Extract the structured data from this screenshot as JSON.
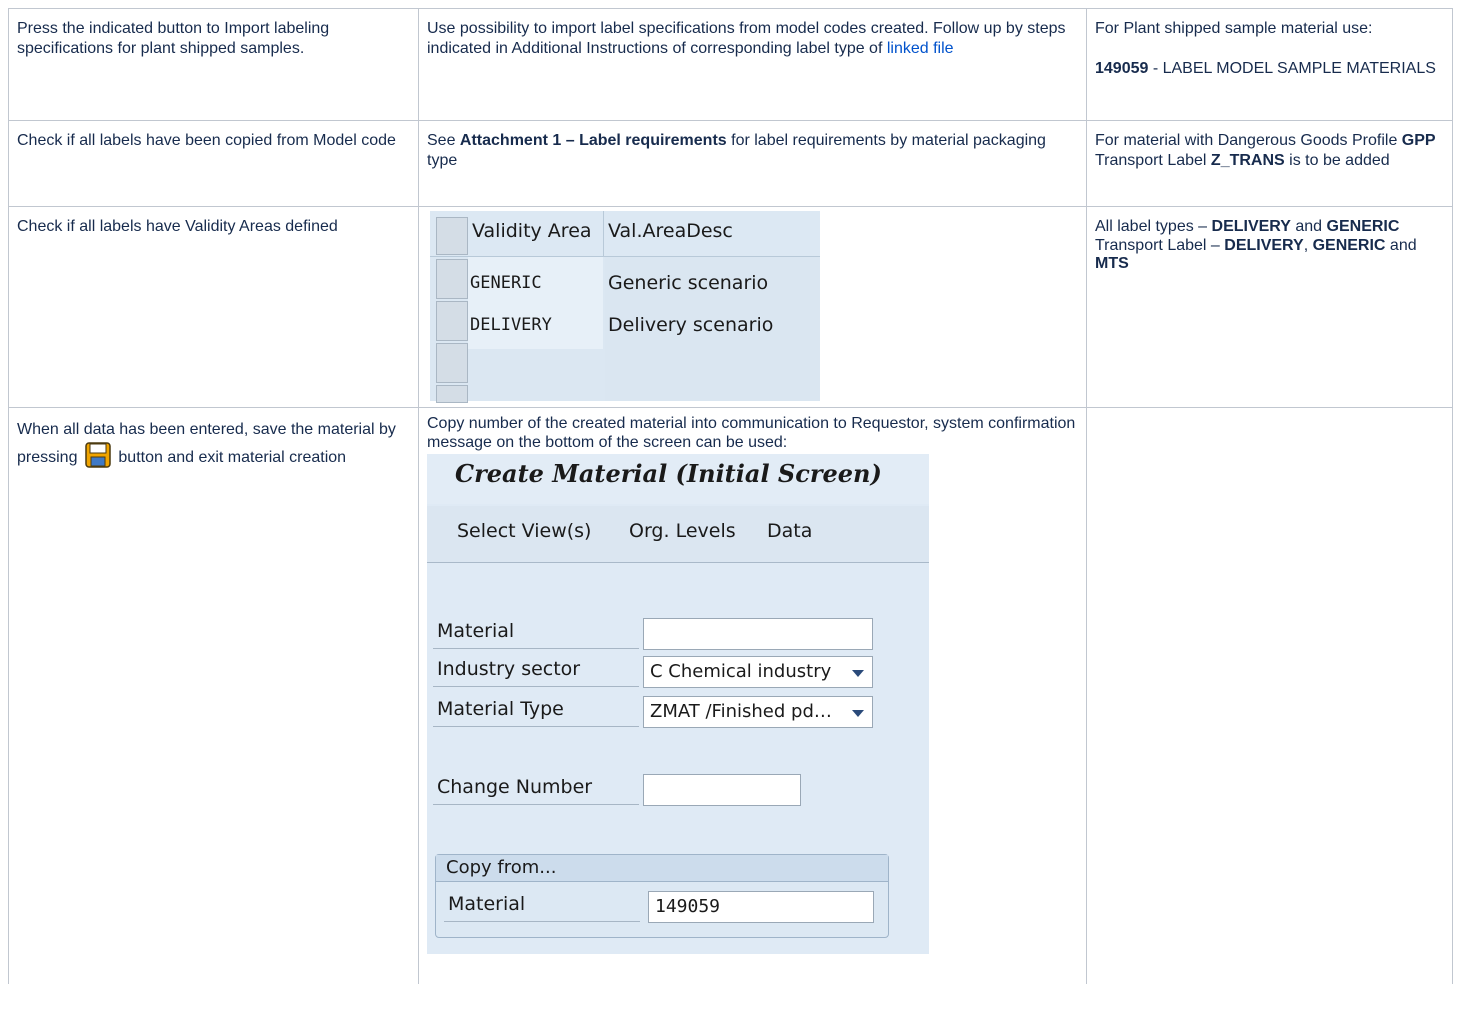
{
  "rows": [
    {
      "col1": "Press the indicated button to Import labeling specifications for plant shipped samples.",
      "col2_text": "Use possibility to import label specifications from model codes created. Follow up by steps indicated in Additional Instructions of corresponding label type of ",
      "col2_link": "linked file",
      "col3_line1": "For Plant shipped sample material use:",
      "col3_bold": "149059",
      "col3_rest": " - LABEL MODEL SAMPLE MATERIALS"
    },
    {
      "col1": "Check if all labels have been copied from Model code",
      "col2_pre": "See ",
      "col2_bold": "Attachment 1 – Label requirements",
      "col2_post": " for label requirements by material packaging type",
      "col3_a": "For material with Dangerous Goods Profile ",
      "col3_b": "GPP",
      "col3_c": " Transport Label ",
      "col3_d": "Z_TRANS",
      "col3_e": " is to be added"
    },
    {
      "col1": "Check if all labels have Validity Areas defined",
      "col3_a": "All label types – ",
      "col3_b": "DELIVERY",
      "col3_c": " and ",
      "col3_d": "GENERIC",
      "col3_e": "Transport Label – ",
      "col3_f": "DELIVERY",
      "col3_g": ", ",
      "col3_h": "GENERIC",
      "col3_i": " and ",
      "col3_j": "MTS"
    },
    {
      "col1_a": "When all data has been entered, save the material by pressing",
      "col1_b": "button and exit material creation",
      "col2_text": "Copy number of the created material into communication to Requestor, system confirmation message on the bottom of the screen can be used:"
    }
  ],
  "validity_grid": {
    "headers": [
      "Validity Area",
      "Val.AreaDesc"
    ],
    "rows": [
      {
        "code": "GENERIC",
        "desc": "Generic scenario"
      },
      {
        "code": "DELIVERY",
        "desc": "Delivery scenario"
      }
    ]
  },
  "sap_screen": {
    "title": "Create Material (Initial Screen)",
    "menu": [
      "Select View(s)",
      "Org. Levels",
      "Data"
    ],
    "fields": {
      "material_label": "Material",
      "material_value": "",
      "industry_label": "Industry sector",
      "industry_value": "C Chemical industry",
      "type_label": "Material Type",
      "type_value": "ZMAT /Finished pd…",
      "change_label": "Change Number",
      "change_value": ""
    },
    "copy_from": {
      "title": "Copy from...",
      "label": "Material",
      "value": "149059"
    }
  },
  "colors": {
    "link": "#0052cc",
    "border": "#c1c7d0",
    "sap_bg": "#dfeaf5",
    "save_icon": "#e8a000"
  },
  "icons": {
    "save": "floppy-disk-icon",
    "dropdown": "triangle-down-icon"
  }
}
